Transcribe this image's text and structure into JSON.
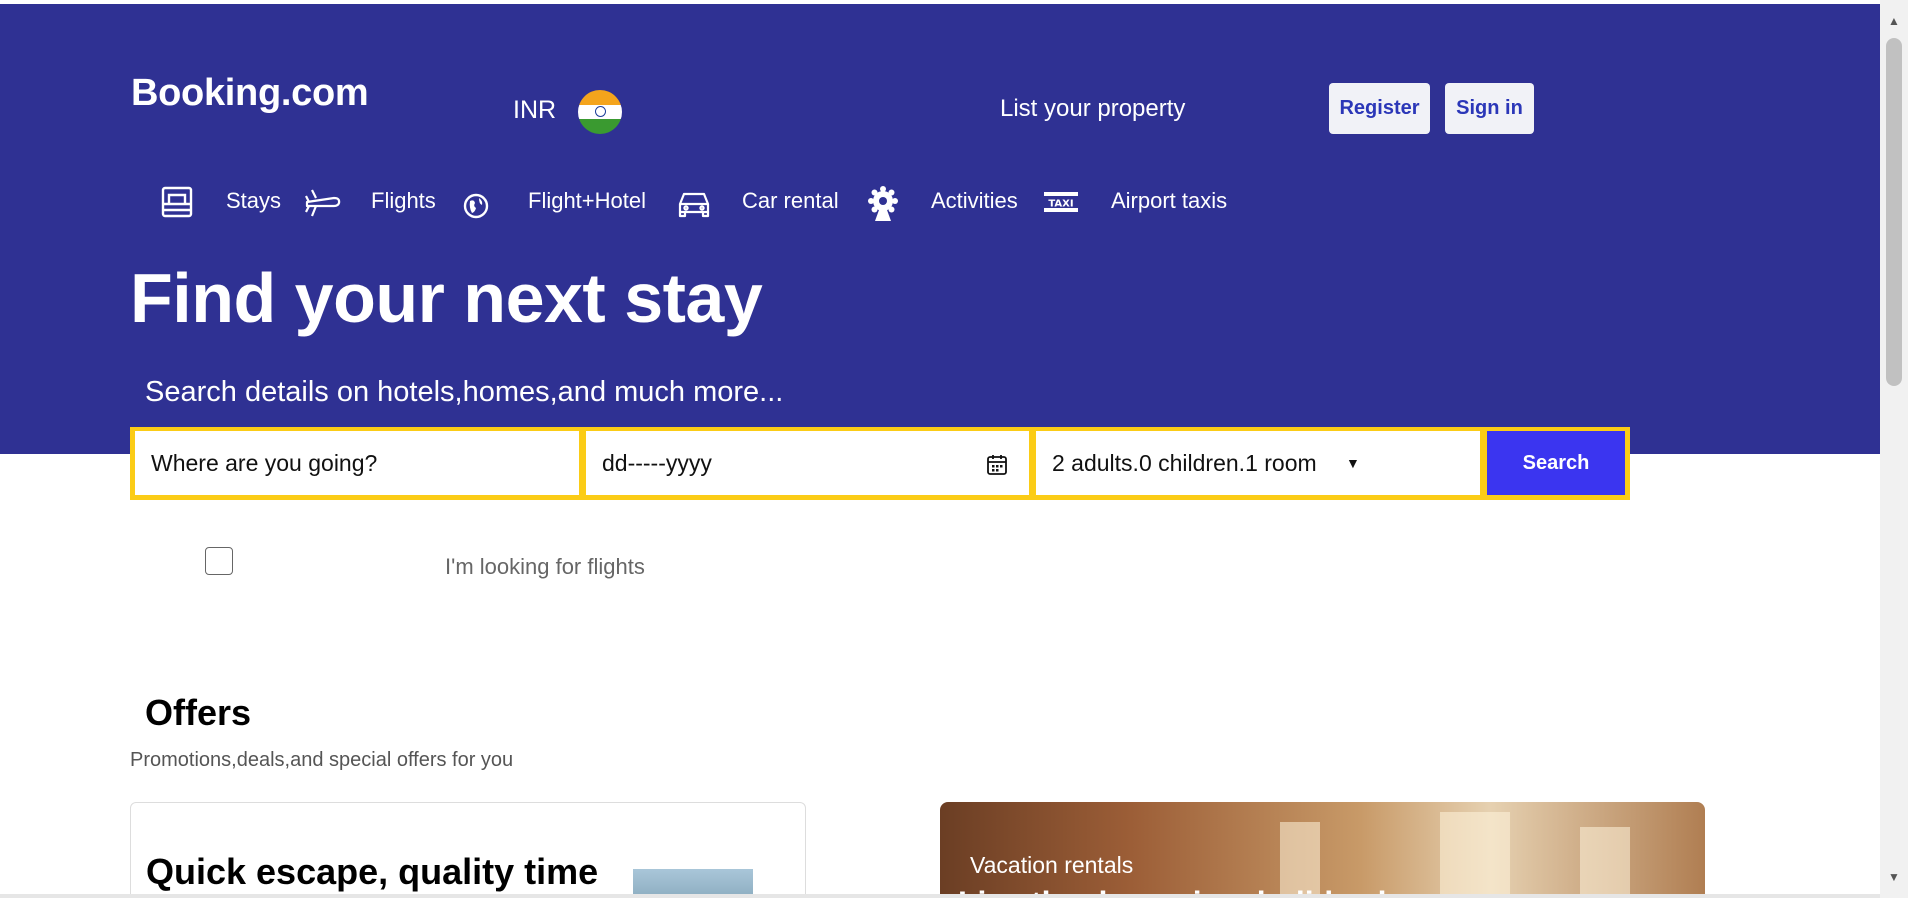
{
  "header": {
    "logo": "Booking.com",
    "currency": "INR",
    "flag_icon": "india-flag-icon",
    "list_property": "List your property",
    "register_label": "Register",
    "signin_label": "Sign in"
  },
  "nav": {
    "items": [
      {
        "label": "Stays",
        "icon": "bed-icon"
      },
      {
        "label": "Flights",
        "icon": "plane-icon"
      },
      {
        "label": "Flight+Hotel",
        "icon": "globe-icon"
      },
      {
        "label": "Car rental",
        "icon": "car-icon"
      },
      {
        "label": "Activities",
        "icon": "attractions-icon"
      },
      {
        "label": "Airport taxis",
        "icon": "taxi-icon"
      }
    ]
  },
  "hero": {
    "title": "Find your next stay",
    "subtitle": "Search details on hotels,homes,and much more..."
  },
  "search": {
    "destination_placeholder": "Where are you going?",
    "date_placeholder": "dd-----yyyy",
    "guests_value": "2 adults.0 children.1 room",
    "button_label": "Search"
  },
  "flights_checkbox": {
    "label": "I'm looking for flights",
    "checked": false
  },
  "offers": {
    "title": "Offers",
    "subtitle": "Promotions,deals,and special offers for you",
    "cards": [
      {
        "title": "Quick escape, quality time"
      },
      {
        "label": "Vacation rentals",
        "title": "Live the dream in a holiday home"
      }
    ]
  },
  "colors": {
    "brand_blue": "#2f3193",
    "search_border": "#fbcc16",
    "search_button": "#3b35f0"
  }
}
